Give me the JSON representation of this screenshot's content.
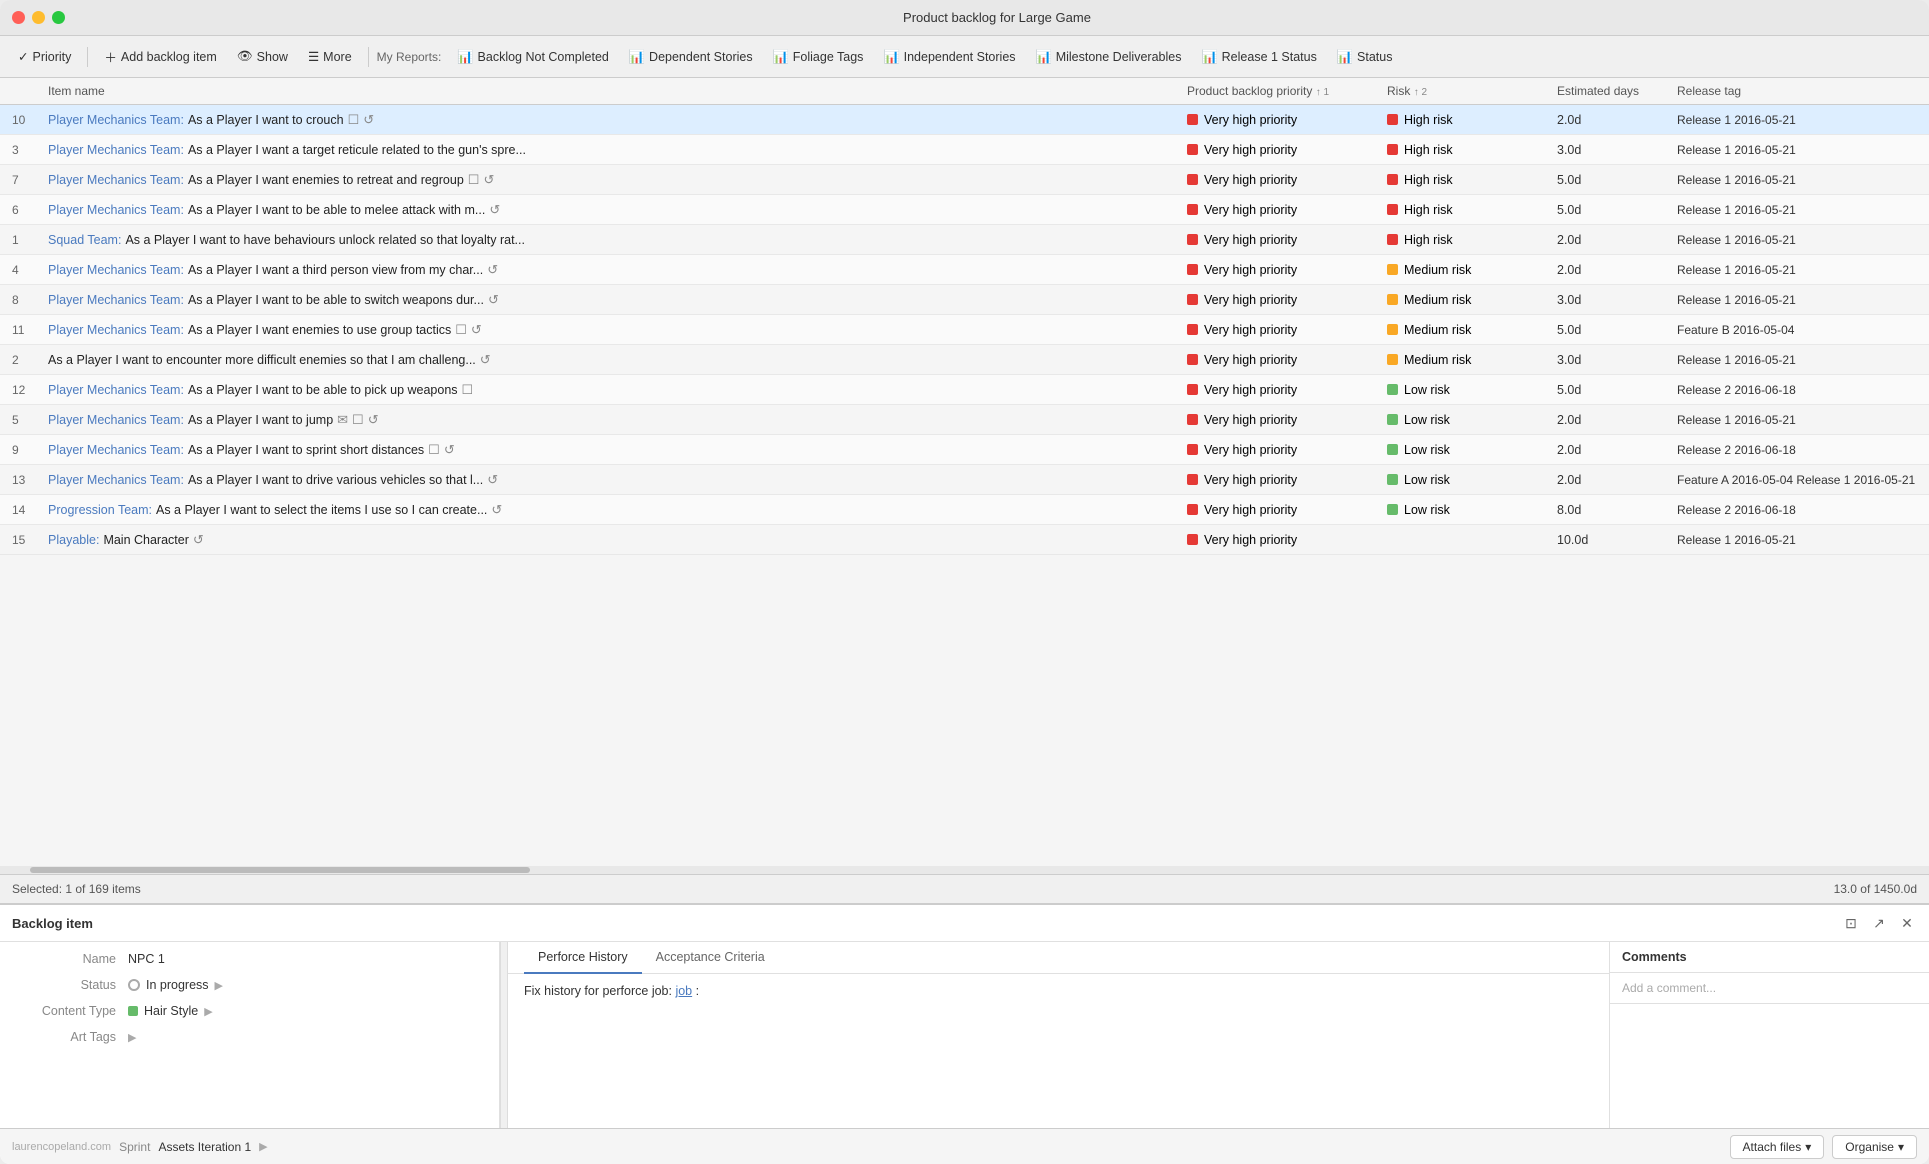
{
  "window": {
    "title": "Product backlog for Large Game",
    "traffic_lights": [
      "close",
      "minimize",
      "maximize"
    ]
  },
  "toolbar": {
    "priority_label": "Priority",
    "add_backlog_label": "Add backlog item",
    "show_label": "Show",
    "more_label": "More",
    "my_reports_label": "My Reports:",
    "reports": [
      {
        "label": "Backlog Not Completed"
      },
      {
        "label": "Dependent Stories"
      },
      {
        "label": "Foliage Tags"
      },
      {
        "label": "Independent Stories"
      },
      {
        "label": "Milestone Deliverables"
      },
      {
        "label": "Release 1 Status"
      },
      {
        "label": "Status"
      }
    ]
  },
  "table": {
    "columns": [
      {
        "id": "num",
        "label": ""
      },
      {
        "id": "name",
        "label": "Item name"
      },
      {
        "id": "priority",
        "label": "Product backlog priority",
        "sort": "↑ 1"
      },
      {
        "id": "risk",
        "label": "Risk",
        "sort": "↑ 2"
      },
      {
        "id": "days",
        "label": "Estimated days"
      },
      {
        "id": "release",
        "label": "Release tag"
      }
    ],
    "rows": [
      {
        "num": "10",
        "team": "Player Mechanics Team:",
        "desc": "As a Player I want to crouch",
        "icons": [
          "checkbox",
          "spin"
        ],
        "priority": "Very high priority",
        "priority_color": "red",
        "risk": "High risk",
        "risk_color": "red",
        "days": "2.0d",
        "release": "Release 1",
        "release_date": "2016-05-21"
      },
      {
        "num": "3",
        "team": "Player Mechanics Team:",
        "desc": "As a Player I want a target reticule related to the gun's spre...",
        "icons": [],
        "priority": "Very high priority",
        "priority_color": "red",
        "risk": "High risk",
        "risk_color": "red",
        "days": "3.0d",
        "release": "Release 1",
        "release_date": "2016-05-21"
      },
      {
        "num": "7",
        "team": "Player Mechanics Team:",
        "desc": "As a Player I want enemies to retreat and regroup",
        "icons": [
          "checkbox",
          "spin"
        ],
        "priority": "Very high priority",
        "priority_color": "red",
        "risk": "High risk",
        "risk_color": "red",
        "days": "5.0d",
        "release": "Release 1",
        "release_date": "2016-05-21"
      },
      {
        "num": "6",
        "team": "Player Mechanics Team:",
        "desc": "As a Player I want to be able to melee attack with m...",
        "icons": [
          "spin"
        ],
        "priority": "Very high priority",
        "priority_color": "red",
        "risk": "High risk",
        "risk_color": "red",
        "days": "5.0d",
        "release": "Release 1",
        "release_date": "2016-05-21"
      },
      {
        "num": "1",
        "team": "Squad Team:",
        "desc": "As a Player I want to have behaviours unlock related so that loyalty rat...",
        "icons": [],
        "priority": "Very high priority",
        "priority_color": "red",
        "risk": "High risk",
        "risk_color": "red",
        "days": "2.0d",
        "release": "Release 1",
        "release_date": "2016-05-21"
      },
      {
        "num": "4",
        "team": "Player Mechanics Team:",
        "desc": "As a Player I want a third person view from my char...",
        "icons": [
          "spin"
        ],
        "priority": "Very high priority",
        "priority_color": "red",
        "risk": "Medium risk",
        "risk_color": "yellow",
        "days": "2.0d",
        "release": "Release 1",
        "release_date": "2016-05-21"
      },
      {
        "num": "8",
        "team": "Player Mechanics Team:",
        "desc": "As a Player I want to be able to switch weapons dur...",
        "icons": [
          "spin"
        ],
        "priority": "Very high priority",
        "priority_color": "red",
        "risk": "Medium risk",
        "risk_color": "yellow",
        "days": "3.0d",
        "release": "Release 1",
        "release_date": "2016-05-21"
      },
      {
        "num": "11",
        "team": "Player Mechanics Team:",
        "desc": "As a Player I want enemies to use group tactics",
        "icons": [
          "checkbox",
          "spin"
        ],
        "priority": "Very high priority",
        "priority_color": "red",
        "risk": "Medium risk",
        "risk_color": "yellow",
        "days": "5.0d",
        "release": "Feature B",
        "release_date": "2016-05-04"
      },
      {
        "num": "2",
        "team": "",
        "desc": "As a Player I want to encounter more difficult enemies so that I am challeng...",
        "icons": [
          "spin"
        ],
        "priority": "Very high priority",
        "priority_color": "red",
        "risk": "Medium risk",
        "risk_color": "yellow",
        "days": "3.0d",
        "release": "Release 1",
        "release_date": "2016-05-21"
      },
      {
        "num": "12",
        "team": "Player Mechanics Team:",
        "desc": "As a Player I want to be able to pick up weapons",
        "icons": [
          "checkbox"
        ],
        "priority": "Very high priority",
        "priority_color": "red",
        "risk": "Low risk",
        "risk_color": "green",
        "days": "5.0d",
        "release": "Release 2",
        "release_date": "2016-06-18"
      },
      {
        "num": "5",
        "team": "Player Mechanics Team:",
        "desc": "As a Player I want to jump",
        "icons": [
          "mail",
          "checkbox",
          "spin"
        ],
        "priority": "Very high priority",
        "priority_color": "red",
        "risk": "Low risk",
        "risk_color": "green",
        "days": "2.0d",
        "release": "Release 1",
        "release_date": "2016-05-21"
      },
      {
        "num": "9",
        "team": "Player Mechanics Team:",
        "desc": "As a Player I want to sprint short distances",
        "icons": [
          "checkbox",
          "spin"
        ],
        "priority": "Very high priority",
        "priority_color": "red",
        "risk": "Low risk",
        "risk_color": "green",
        "days": "2.0d",
        "release": "Release 2",
        "release_date": "2016-06-18"
      },
      {
        "num": "13",
        "team": "Player Mechanics Team:",
        "desc": "As a Player I want to drive various vehicles so that l...",
        "icons": [
          "spin"
        ],
        "priority": "Very high priority",
        "priority_color": "red",
        "risk": "Low risk",
        "risk_color": "green",
        "days": "2.0d",
        "release": "Feature A",
        "release_date": "2016-05-04",
        "extra": "Release 1  2016-05-21"
      },
      {
        "num": "14",
        "team": "Progression Team:",
        "desc": "As a Player I want to select the items I use so I can create...",
        "icons": [
          "spin"
        ],
        "priority": "Very high priority",
        "priority_color": "red",
        "risk": "Low risk",
        "risk_color": "green",
        "days": "8.0d",
        "release": "Release 2",
        "release_date": "2016-06-18"
      },
      {
        "num": "15",
        "team": "Playable:",
        "desc": "Main Character",
        "icons": [
          "spin"
        ],
        "priority": "Very high priority",
        "priority_color": "red",
        "risk": "",
        "risk_color": "",
        "days": "10.0d",
        "release": "Release 1",
        "release_date": "2016-05-21"
      }
    ]
  },
  "status_bar": {
    "selected": "Selected: 1 of 169 items",
    "total": "13.0 of 1450.0d"
  },
  "bottom_panel": {
    "title": "Backlog item",
    "details": {
      "name_label": "Name",
      "name_value": "NPC 1",
      "status_label": "Status",
      "status_value": "In progress",
      "content_type_label": "Content Type",
      "content_type_value": "Hair Style",
      "art_tags_label": "Art Tags",
      "art_tags_value": "",
      "sprint_label": "Sprint",
      "sprint_value": "Assets Iteration 1"
    },
    "tabs": [
      {
        "id": "perforce",
        "label": "Perforce History",
        "active": true
      },
      {
        "id": "acceptance",
        "label": "Acceptance Criteria",
        "active": false
      }
    ],
    "perforce_content": "Fix history for perforce job:",
    "perforce_link": "job",
    "comments": {
      "title": "Comments",
      "placeholder": "Add a comment..."
    },
    "footer": {
      "attach_label": "Attach files",
      "organise_label": "Organise",
      "watermark": "laurencopeland.com"
    }
  }
}
